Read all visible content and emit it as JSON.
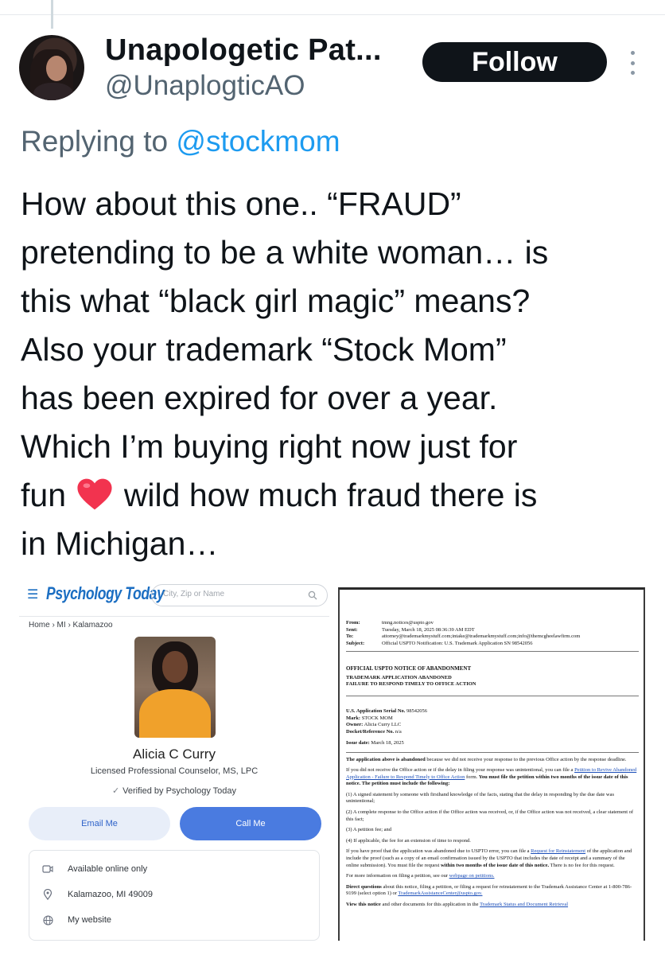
{
  "author": {
    "display_name": "Unapologetic Pat...",
    "handle": "@UnaplogticAO",
    "follow_label": "Follow"
  },
  "reply": {
    "prefix": "Replying to",
    "mention": "@stockmom"
  },
  "tweet": {
    "lines": [
      "How about this one.. “FRAUD”",
      "pretending to be a white woman… is",
      "this what “black girl magic” means?",
      "Also your trademark “Stock Mom”",
      "has been expired for over a year.",
      "Which I’m buying right now just for"
    ],
    "line7_before": "fun",
    "line7_after": "wild how much fraud there is",
    "line8": "in Michigan…",
    "heart_color": "#f2334f"
  },
  "psychology_today": {
    "logo": "Psychology Today",
    "search_placeholder": "City, Zip or Name",
    "breadcrumb": "Home  ›  MI  ›  Kalamazoo",
    "name": "Alicia C Curry",
    "credentials": "Licensed Professional Counselor, MS, LPC",
    "verified": "Verified by Psychology Today",
    "email_label": "Email Me",
    "call_label": "Call Me",
    "info": {
      "availability": "Available online only",
      "location": "Kalamazoo, MI 49009",
      "website": "My website"
    }
  },
  "uspto_doc": {
    "header": [
      {
        "k": "From:",
        "v": "tmng.notices@uspto.gov"
      },
      {
        "k": "Sent:",
        "v": "Tuesday, March 18, 2025 08:36:39 AM EDT"
      },
      {
        "k": "To:",
        "v": "attorney@trademarkmystuff.com;intake@trademarkmystuff.com;info@themcgheelawfirm.com"
      },
      {
        "k": "Subject:",
        "v": "Official USPTO Notification: U.S. Trademark Application SN 98542056"
      }
    ],
    "title1": "OFFICIAL USPTO NOTICE OF ABANDONMENT",
    "title2": "TRADEMARK APPLICATION ABANDONED",
    "title3": "FAILURE TO RESPOND TIMELY TO OFFICE ACTION",
    "serial_label": "U.S. Application Serial No.",
    "serial": "98542056",
    "mark_label": "Mark:",
    "mark": "STOCK MOM",
    "owner_label": "Owner:",
    "owner": "Alicia Curry LLC",
    "docket_label": "Docket/Reference No.",
    "docket": "n/a",
    "issue_label": "Issue date:",
    "issue_date": "March 18, 2025",
    "p1_bold": "The application above is abandoned",
    "p1_rest": "because we did not receive your response to the previous Office action by the response deadline.",
    "p2_a": "If you did not receive the Office action or if the delay in filing your response was unintentional, you can file a",
    "p2_link": "Petition to Revive Abandoned Application - Failure to Respond Timely to Office Action",
    "p2_b": "form.",
    "p2_bold": "You must file the petition within two months of the issue date of this notice.  The petition must include the following:",
    "item1": "(1)  A signed statement by someone with firsthand knowledge of the facts, stating that the delay in responding by the due date was unintentional;",
    "item2": "(2)  A complete response to the Office action if the Office action was received, or, if the Office action was not received, a clear statement of this fact;",
    "item3": "(3)  A petition fee; and",
    "item4": "(4)  If applicable, the fee for an extension of time to respond.",
    "p3_a": "If you have proof that the application was abandoned due to USPTO error, you can file a",
    "p3_link": "Request for Reinstatement",
    "p3_b": "of the application and include the proof (such as a copy of an email confirmation issued by the USPTO that includes the date of receipt and a summary of the online submission).  You must file the request",
    "p3_bold": "within two months of the issue date of this notice.",
    "p3_c": "There is no fee for this request.",
    "p4_a": "For more information on filing a petition, see our",
    "p4_link": "webpage on petitions.",
    "p5_bold": "Direct questions",
    "p5_a": "about this notice, filing a petition, or filing a request for reinstatement to the Trademark Assistance Center at 1-800-786-9199 (select option 1) or",
    "p5_link": "TrademarkAssistanceCenter@uspto.gov.",
    "p6_bold": "View this notice",
    "p6_a": "and other documents for this application in the",
    "p6_link": "Trademark Status and Document Retrieval"
  }
}
